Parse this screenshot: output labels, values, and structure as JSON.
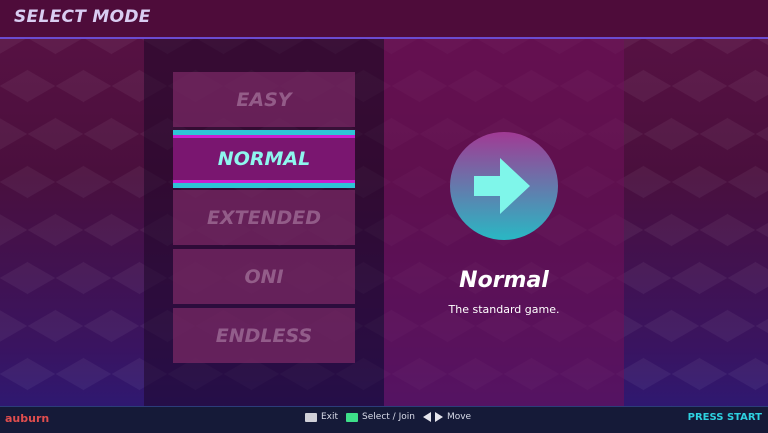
{
  "header": {
    "title": "SELECT MODE"
  },
  "modes": [
    {
      "label": "EASY",
      "selected": false
    },
    {
      "label": "NORMAL",
      "selected": true
    },
    {
      "label": "EXTENDED",
      "selected": false
    },
    {
      "label": "ONI",
      "selected": false
    },
    {
      "label": "ENDLESS",
      "selected": false
    }
  ],
  "detail": {
    "icon": "arrow-right-icon",
    "title": "Normal",
    "description": "The standard game."
  },
  "footer": {
    "user": "auburn",
    "hints": {
      "exit_label": "Exit",
      "select_label": "Select / Join",
      "move_label": "Move"
    },
    "press_start": "PRESS START"
  },
  "colors": {
    "accent_cyan": "#2ec4d6",
    "accent_magenta": "#c81fcf",
    "selected_text": "#8ef6ee",
    "user_name": "#e14e4e",
    "press_start": "#2ed1e0",
    "exit_key": "#d0d0d8",
    "select_key": "#3ee08a"
  }
}
